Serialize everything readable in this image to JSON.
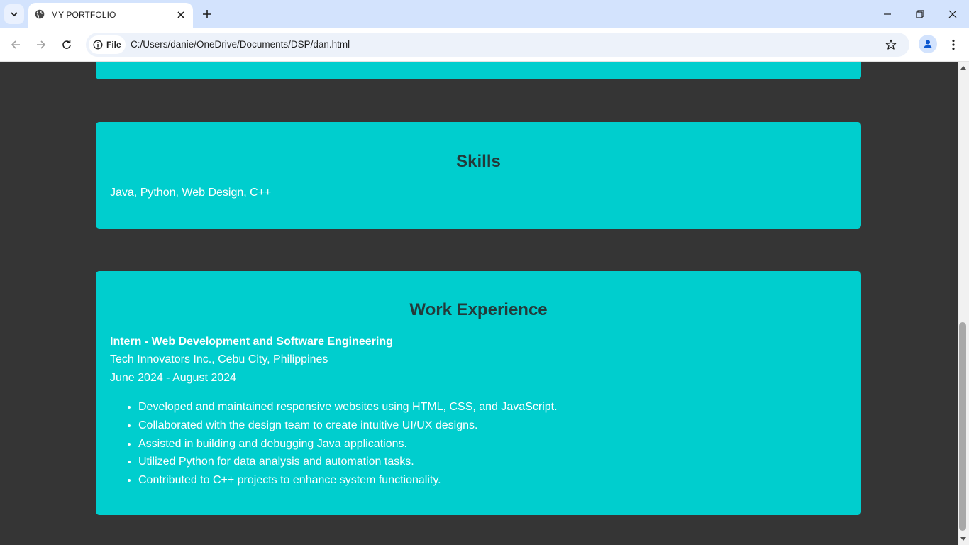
{
  "browser": {
    "tab_title": "MY PORTFOLIO",
    "site_chip_label": "File",
    "url": "C:/Users/danie/OneDrive/Documents/DSP/dan.html"
  },
  "page": {
    "skills": {
      "heading": "Skills",
      "text": "Java, Python, Web Design, C++"
    },
    "work": {
      "heading": "Work Experience",
      "job_title": "Intern - Web Development and Software Engineering",
      "company": "Tech Innovators Inc., Cebu City, Philippines",
      "dates": "June 2024 - August 2024",
      "duties": [
        "Developed and maintained responsive websites using HTML, CSS, and JavaScript.",
        "Collaborated with the design team to create intuitive UI/UX designs.",
        "Assisted in building and debugging Java applications.",
        "Utilized Python for data analysis and automation tasks.",
        "Contributed to C++ projects to enhance system functionality."
      ]
    }
  },
  "colors": {
    "page_background": "#353535",
    "card_background": "#00cece",
    "heading_color": "#243a3a",
    "tabbar_background": "#d3e3fd"
  },
  "scrollbar": {
    "scroll_position_fraction": 1.0
  }
}
